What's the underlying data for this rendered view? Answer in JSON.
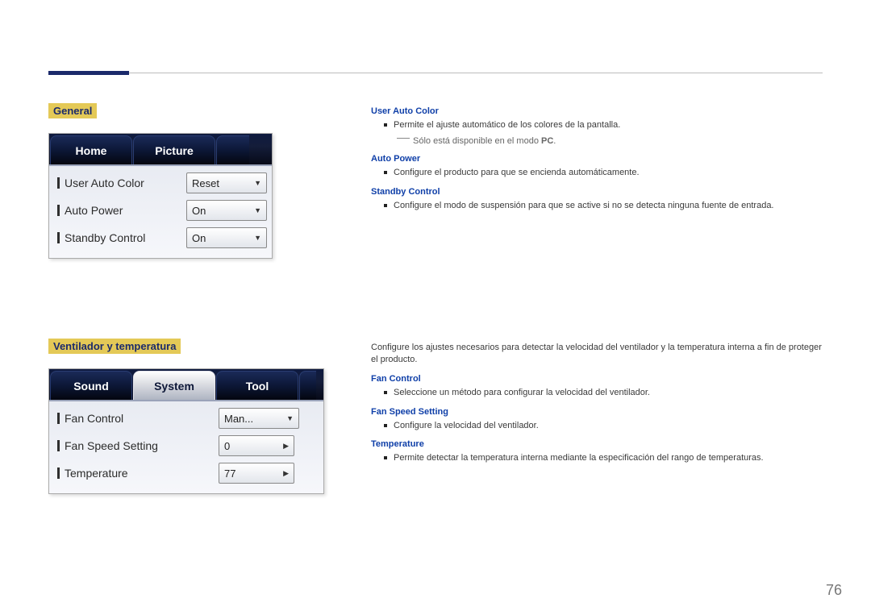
{
  "page_number": "76",
  "section1": {
    "title": "General",
    "tabs": [
      "Home",
      "Picture"
    ],
    "rows": [
      {
        "label": "User Auto Color",
        "value": "Reset",
        "kind": "dropdown"
      },
      {
        "label": "Auto Power",
        "value": "On",
        "kind": "dropdown"
      },
      {
        "label": "Standby Control",
        "value": "On",
        "kind": "dropdown"
      }
    ],
    "desc": {
      "user_auto_color": {
        "heading": "User Auto Color",
        "bullet": "Permite el ajuste automático de los colores de la pantalla.",
        "note_prefix": "Sólo está disponible en el modo ",
        "note_bold": "PC",
        "note_suffix": "."
      },
      "auto_power": {
        "heading": "Auto Power",
        "bullet": "Configure el producto para que se encienda automáticamente."
      },
      "standby_control": {
        "heading": "Standby Control",
        "bullet": "Configure el modo de suspensión para que se active si no se detecta ninguna fuente de entrada."
      }
    }
  },
  "section2": {
    "title": "Ventilador y temperatura",
    "tabs": [
      "Sound",
      "System",
      "Tool"
    ],
    "active_tab_index": 1,
    "rows": [
      {
        "label": "Fan Control",
        "value": "Man...",
        "kind": "dropdown"
      },
      {
        "label": "Fan Speed Setting",
        "value": "0",
        "kind": "spinner"
      },
      {
        "label": "Temperature",
        "value": "77",
        "kind": "spinner"
      }
    ],
    "intro": "Configure los ajustes necesarios para detectar la velocidad del ventilador y la temperatura interna a fin de proteger el producto.",
    "desc": {
      "fan_control": {
        "heading": "Fan Control",
        "bullet": "Seleccione un método para configurar la velocidad del ventilador."
      },
      "fan_speed_setting": {
        "heading": "Fan Speed Setting",
        "bullet": "Configure la velocidad del ventilador."
      },
      "temperature": {
        "heading": "Temperature",
        "bullet": "Permite detectar la temperatura interna mediante la especificación del rango de temperaturas."
      }
    }
  }
}
